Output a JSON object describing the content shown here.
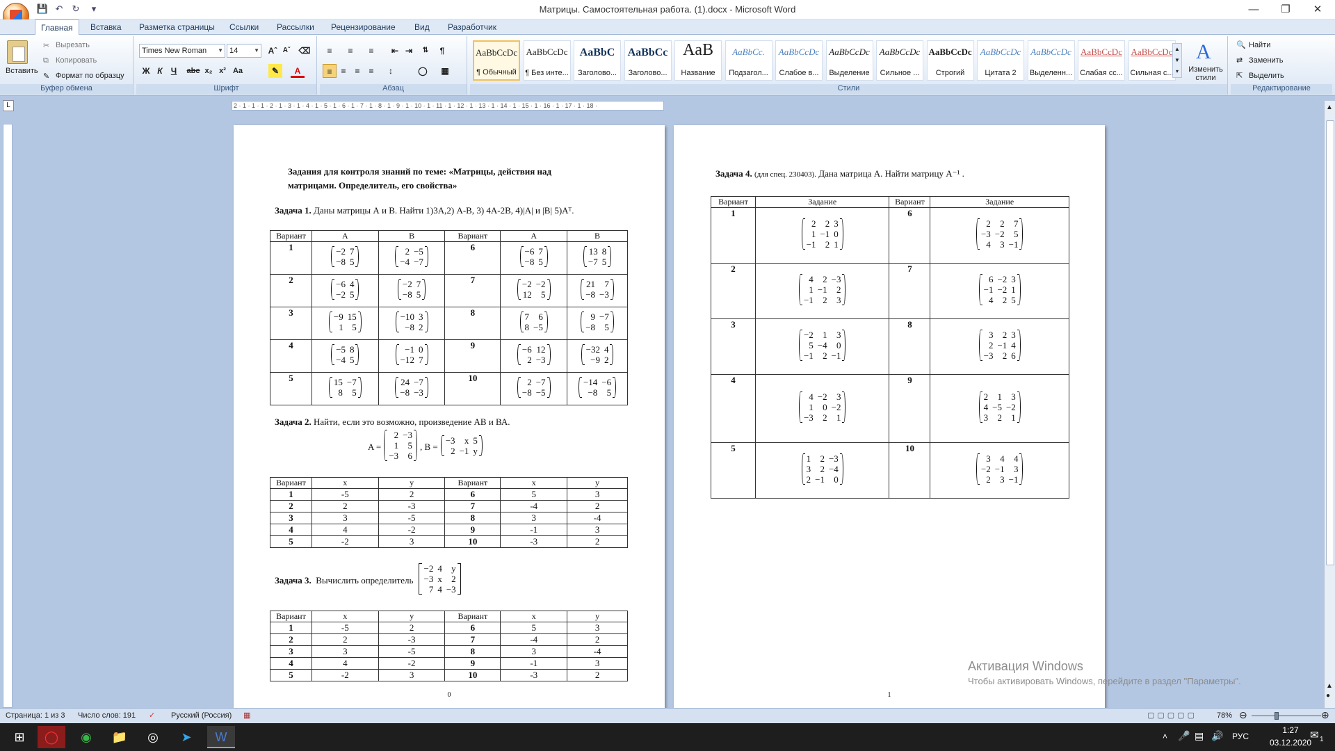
{
  "window": {
    "title": "Матрицы. Самостоятельная работа. (1).docx - Microsoft Word"
  },
  "tabs": [
    "Главная",
    "Вставка",
    "Разметка страницы",
    "Ссылки",
    "Рассылки",
    "Рецензирование",
    "Вид",
    "Разработчик"
  ],
  "clipboard": {
    "paste": "Вставить",
    "cut": "Вырезать",
    "copy": "Копировать",
    "format_painter": "Формат по образцу",
    "label": "Буфер обмена"
  },
  "font": {
    "name": "Times New Roman",
    "size": "14",
    "label": "Шрифт"
  },
  "paragraph": {
    "label": "Абзац"
  },
  "styles": {
    "label": "Стили",
    "change": "Изменить стили",
    "items": [
      {
        "preview": "AaBbCcDc",
        "name": "¶ Обычный"
      },
      {
        "preview": "AaBbCcDc",
        "name": "¶ Без инте..."
      },
      {
        "preview": "AaBbC",
        "name": "Заголово..."
      },
      {
        "preview": "AaBbCc",
        "name": "Заголово..."
      },
      {
        "preview": "AaB",
        "name": "Название"
      },
      {
        "preview": "AaBbCc.",
        "name": "Подзагол..."
      },
      {
        "preview": "AaBbCcDc",
        "name": "Слабое в..."
      },
      {
        "preview": "AaBbCcDc",
        "name": "Выделение"
      },
      {
        "preview": "AaBbCcDc",
        "name": "Сильное ..."
      },
      {
        "preview": "AaBbCcDc",
        "name": "Строгий"
      },
      {
        "preview": "AaBbCcDc",
        "name": "Цитата 2"
      },
      {
        "preview": "AaBbCcDc",
        "name": "Выделенн..."
      },
      {
        "preview": "AaBbCcDc",
        "name": "Слабая сс..."
      },
      {
        "preview": "AaBbCcDc",
        "name": "Сильная с..."
      }
    ]
  },
  "editing": {
    "find": "Найти",
    "replace": "Заменить",
    "select": "Выделить",
    "label": "Редактирование"
  },
  "ruler": "2 · 1 · 1 · 1 · 2 · 1 · 3 · 1 · 4 · 1 · 5 · 1 · 6 · 1 · 7 · 1 · 8 · 1 · 9 · 1 · 10 · 1 · 11 · 1 · 12 · 1 · 13 · 1 · 14 · 1 · 15 · 1 · 16 · 1 · 17 · 1 · 18 ·",
  "page1": {
    "heading1": "Задания для контроля знаний по теме: «Матрицы, действия над",
    "heading2": "матрицами. Определитель, его свойства»",
    "task1_label": "Задача 1.",
    "task1_text": "Даны матрицы А и В. Найти  1)3А,2) А-В, 3) 4А-2В, 4)|A| и |B| 5)Аᵀ.",
    "table1_headers": [
      "Вариант",
      "А",
      "В",
      "Вариант",
      "А",
      "В"
    ],
    "table1_rows": [
      {
        "v1": "1",
        "a1": [
          [
            "−2",
            "7"
          ],
          [
            "−8",
            "5"
          ]
        ],
        "b1": [
          [
            "2",
            "−5"
          ],
          [
            "−4",
            "−7"
          ]
        ],
        "v2": "6",
        "a2": [
          [
            "−6",
            "7"
          ],
          [
            "−8",
            "5"
          ]
        ],
        "b2": [
          [
            "13",
            "8"
          ],
          [
            "−7",
            "5"
          ]
        ]
      },
      {
        "v1": "2",
        "a1": [
          [
            "−6",
            "4"
          ],
          [
            "−2",
            "5"
          ]
        ],
        "b1": [
          [
            "−2",
            "7"
          ],
          [
            "−8",
            "5"
          ]
        ],
        "v2": "7",
        "a2": [
          [
            "−2",
            "−2"
          ],
          [
            "12",
            "5"
          ]
        ],
        "b2": [
          [
            "21",
            "7"
          ],
          [
            "−8",
            "−3"
          ]
        ]
      },
      {
        "v1": "3",
        "a1": [
          [
            "−9",
            "15"
          ],
          [
            "1",
            "5"
          ]
        ],
        "b1": [
          [
            "−10",
            "3"
          ],
          [
            "−8",
            "2"
          ]
        ],
        "v2": "8",
        "a2": [
          [
            "7",
            "6"
          ],
          [
            "8",
            "−5"
          ]
        ],
        "b2": [
          [
            "9",
            "−7"
          ],
          [
            "−8",
            "5"
          ]
        ]
      },
      {
        "v1": "4",
        "a1": [
          [
            "−5",
            "8"
          ],
          [
            "−4",
            "5"
          ]
        ],
        "b1": [
          [
            "−1",
            "0"
          ],
          [
            "−12",
            "7"
          ]
        ],
        "v2": "9",
        "a2": [
          [
            "−6",
            "12"
          ],
          [
            "2",
            "−3"
          ]
        ],
        "b2": [
          [
            "−32",
            "4"
          ],
          [
            "−9",
            "2"
          ]
        ]
      },
      {
        "v1": "5",
        "a1": [
          [
            "15",
            "−7"
          ],
          [
            "8",
            "5"
          ]
        ],
        "b1": [
          [
            "24",
            "−7"
          ],
          [
            "−8",
            "−3"
          ]
        ],
        "v2": "10",
        "a2": [
          [
            "2",
            "−7"
          ],
          [
            "−8",
            "−5"
          ]
        ],
        "b2": [
          [
            "−14",
            "−6"
          ],
          [
            "−8",
            "5"
          ]
        ]
      }
    ],
    "task2_label": "Задача 2.",
    "task2_text": "Найти, если это возможно,   произведение АВ и ВА.",
    "task2_a_label": "A =",
    "task2_a": [
      [
        "2",
        "−3"
      ],
      [
        "1",
        "5"
      ],
      [
        "−3",
        "6"
      ]
    ],
    "task2_b_label": ", B =",
    "task2_b": [
      [
        "−3",
        "x",
        "5"
      ],
      [
        "2",
        "−1",
        "y"
      ]
    ],
    "xy_headers": [
      "Вариант",
      "x",
      "y",
      "Вариант",
      "x",
      "y"
    ],
    "xy_rows": [
      [
        "1",
        "-5",
        "2",
        "6",
        "5",
        "3"
      ],
      [
        "2",
        "2",
        "-3",
        "7",
        "-4",
        "2"
      ],
      [
        "3",
        "3",
        "-5",
        "8",
        "3",
        "-4"
      ],
      [
        "4",
        "4",
        "-2",
        "9",
        "-1",
        "3"
      ],
      [
        "5",
        "-2",
        "3",
        "10",
        "-3",
        "2"
      ]
    ],
    "task3_label": "Задача 3.",
    "task3_text": "Вычислить определитель",
    "task3_det": [
      [
        "−2",
        "4",
        "y"
      ],
      [
        "−3",
        "x",
        "2"
      ],
      [
        "7",
        "4",
        "−3"
      ]
    ],
    "page_number": "0"
  },
  "page2": {
    "task4_label": "Задача 4.",
    "task4_note": "(для спец. 230403).",
    "task4_text": "Дана матрица А.  Найти матрицу А⁻¹ .",
    "headers": [
      "Вариант",
      "Задание",
      "Вариант",
      "Задание"
    ],
    "rows": [
      {
        "v1": "1",
        "m1": [
          [
            "2",
            "2",
            "3"
          ],
          [
            "1",
            "−1",
            "0"
          ],
          [
            "−1",
            "2",
            "1"
          ]
        ],
        "v2": "6",
        "m2": [
          [
            "2",
            "2",
            "7"
          ],
          [
            "−3",
            "−2",
            "5"
          ],
          [
            "4",
            "3",
            "−1"
          ]
        ]
      },
      {
        "v1": "2",
        "m1": [
          [
            "4",
            "2",
            "−3"
          ],
          [
            "1",
            "−1",
            "2"
          ],
          [
            "−1",
            "2",
            "3"
          ]
        ],
        "v2": "7",
        "m2": [
          [
            "6",
            "−2",
            "3"
          ],
          [
            "−1",
            "−2",
            "1"
          ],
          [
            "4",
            "2",
            "5"
          ]
        ]
      },
      {
        "v1": "3",
        "m1": [
          [
            "−2",
            "1",
            "3"
          ],
          [
            "5",
            "−4",
            "0"
          ],
          [
            "−1",
            "2",
            "−1"
          ]
        ],
        "v2": "8",
        "m2": [
          [
            "3",
            "2",
            "3"
          ],
          [
            "2",
            "−1",
            "4"
          ],
          [
            "−3",
            "2",
            "6"
          ]
        ]
      },
      {
        "v1": "4",
        "m1": [
          [
            "4",
            "−2",
            "3"
          ],
          [
            "1",
            "0",
            "−2"
          ],
          [
            "−3",
            "2",
            "1"
          ]
        ],
        "v2": "9",
        "m2": [
          [
            "2",
            "1",
            "3"
          ],
          [
            "4",
            "−5",
            "−2"
          ],
          [
            "3",
            "2",
            "1"
          ]
        ]
      },
      {
        "v1": "5",
        "m1": [
          [
            "1",
            "2",
            "−3"
          ],
          [
            "3",
            "2",
            "−4"
          ],
          [
            "2",
            "−1",
            "0"
          ]
        ],
        "v2": "10",
        "m2": [
          [
            "3",
            "4",
            "4"
          ],
          [
            "−2",
            "−1",
            "3"
          ],
          [
            "2",
            "3",
            "−1"
          ]
        ]
      }
    ],
    "page_number": "1"
  },
  "watermark": {
    "title": "Активация Windows",
    "subtitle": "Чтобы активировать Windows, перейдите в раздел \"Параметры\"."
  },
  "status": {
    "page": "Страница: 1 из 3",
    "words": "Число слов: 191",
    "language": "Русский (Россия)",
    "zoom": "78%"
  },
  "taskbar": {
    "language": "РУС",
    "time": "1:27",
    "date": "03.12.2020",
    "notifications": "1"
  }
}
